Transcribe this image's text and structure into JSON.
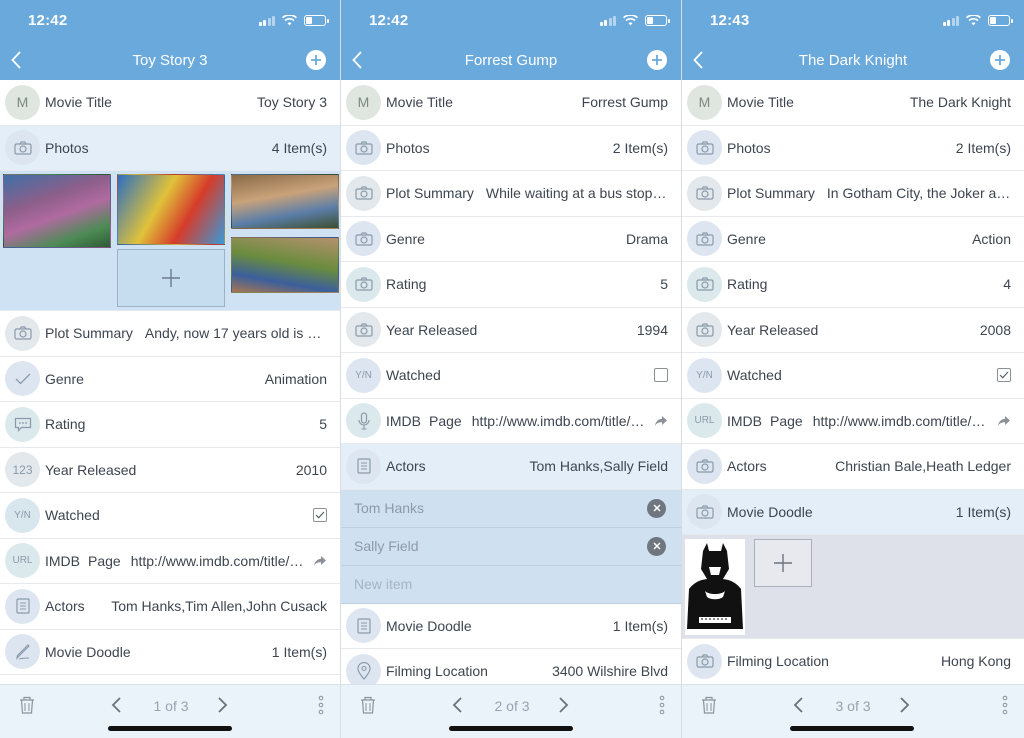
{
  "panels": [
    {
      "time": "12:42",
      "title": "Toy Story 3",
      "rows": {
        "movie_title": {
          "label": "Movie Title",
          "value": "Toy Story 3",
          "icon_text": "M"
        },
        "photos": {
          "label": "Photos",
          "value": "4 Item(s)"
        },
        "plot_summary": {
          "label": "Plot Summary",
          "value": "Andy, now 17 years old is a…"
        },
        "genre": {
          "label": "Genre",
          "value": "Animation"
        },
        "rating": {
          "label": "Rating",
          "value": "5"
        },
        "year_released": {
          "label": "Year Released",
          "value": "2010",
          "icon_text": "123"
        },
        "watched": {
          "label": "Watched",
          "icon_text": "Y/N",
          "checked": true
        },
        "imdb": {
          "label1": "IMDB",
          "label2": "Page",
          "value": "http://www.imdb.com/title/…",
          "icon_text": "URL"
        },
        "actors": {
          "label": "Actors",
          "value": "Tom Hanks,Tim Allen,John Cusack"
        },
        "movie_doodle": {
          "label": "Movie Doodle",
          "value": "1 Item(s)"
        }
      },
      "page_indicator": "1 of 3"
    },
    {
      "time": "12:42",
      "title": "Forrest Gump",
      "rows": {
        "movie_title": {
          "label": "Movie Title",
          "value": "Forrest Gump",
          "icon_text": "M"
        },
        "photos": {
          "label": "Photos",
          "value": "2 Item(s)"
        },
        "plot_summary": {
          "label": "Plot Summary",
          "value": "While waiting at a bus stop,…"
        },
        "genre": {
          "label": "Genre",
          "value": "Drama"
        },
        "rating": {
          "label": "Rating",
          "value": "5"
        },
        "year_released": {
          "label": "Year Released",
          "value": "1994"
        },
        "watched": {
          "label": "Watched",
          "icon_text": "Y/N",
          "checked": false
        },
        "imdb": {
          "label1": "IMDB",
          "label2": "Page",
          "value": "http://www.imdb.com/title/…"
        },
        "actors": {
          "label": "Actors",
          "value": "Tom Hanks,Sally Field"
        },
        "actor_items": [
          "Tom Hanks",
          "Sally Field"
        ],
        "new_item_placeholder": "New item",
        "movie_doodle": {
          "label": "Movie Doodle",
          "value": "1 Item(s)"
        },
        "filming_location": {
          "label": "Filming Location",
          "value": "3400 Wilshire Blvd"
        }
      },
      "page_indicator": "2 of 3"
    },
    {
      "time": "12:43",
      "title": "The Dark Knight",
      "rows": {
        "movie_title": {
          "label": "Movie Title",
          "value": "The Dark Knight",
          "icon_text": "M"
        },
        "photos": {
          "label": "Photos",
          "value": "2 Item(s)"
        },
        "plot_summary": {
          "label": "Plot Summary",
          "value": "In Gotham City, the Joker an…"
        },
        "genre": {
          "label": "Genre",
          "value": "Action"
        },
        "rating": {
          "label": "Rating",
          "value": "4"
        },
        "year_released": {
          "label": "Year Released",
          "value": "2008"
        },
        "watched": {
          "label": "Watched",
          "icon_text": "Y/N",
          "checked": true
        },
        "imdb": {
          "label1": "IMDB",
          "label2": "Page",
          "value": "http://www.imdb.com/title/…",
          "icon_text": "URL"
        },
        "actors": {
          "label": "Actors",
          "value": "Christian Bale,Heath Ledger"
        },
        "movie_doodle": {
          "label": "Movie Doodle",
          "value": "1 Item(s)"
        },
        "filming_location": {
          "label": "Filming Location",
          "value": "Hong Kong"
        }
      },
      "page_indicator": "3 of 3"
    }
  ],
  "colors": {
    "navbar": "#6aa9dc",
    "highlight_row": "#e3eef8",
    "gallery_bg": "#cfe2f3",
    "toolbar_bg": "#eaf2fa",
    "text": "#3d4550"
  }
}
